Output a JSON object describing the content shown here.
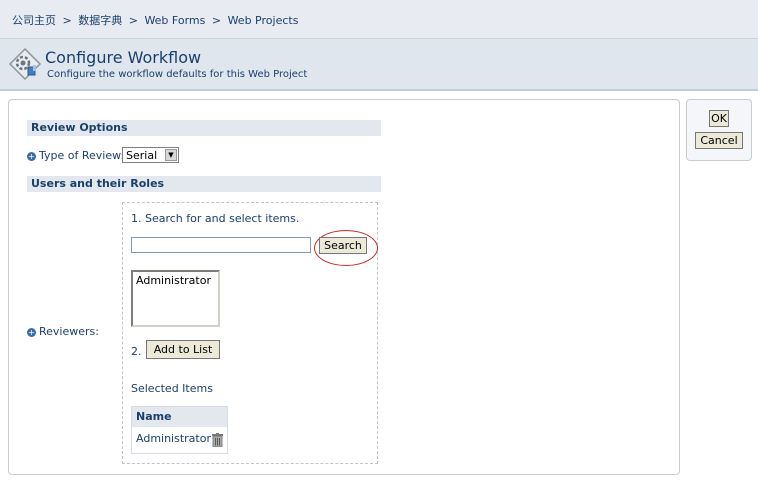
{
  "breadcrumb": {
    "items": [
      "公司主页",
      "数据字典",
      "Web Forms",
      "Web Projects"
    ],
    "separator": ">"
  },
  "header": {
    "title": "Configure Workflow",
    "subtitle": "Configure the workflow defaults for this Web Project",
    "icon": "workflow-gear-icon"
  },
  "review_options": {
    "section_title": "Review Options",
    "type_label": "Type of Review:",
    "type_value": "Serial"
  },
  "users_roles": {
    "section_title": "Users and their Roles",
    "reviewers_label": "Reviewers:",
    "step1_text": "1. Search for and select items.",
    "search_value": "",
    "search_button": "Search",
    "list_options": [
      "Administrator"
    ],
    "step2_num": "2.",
    "add_button": "Add to List",
    "selected_label": "Selected Items",
    "table_header": "Name",
    "selected_rows": [
      "Administrator"
    ]
  },
  "actions": {
    "ok": "OK",
    "cancel": "Cancel"
  },
  "colors": {
    "text": "#1b3f6b",
    "header_bg": "#dfe6ee",
    "section_bg": "#e3e8ee",
    "highlight": "#cc2a2a"
  }
}
